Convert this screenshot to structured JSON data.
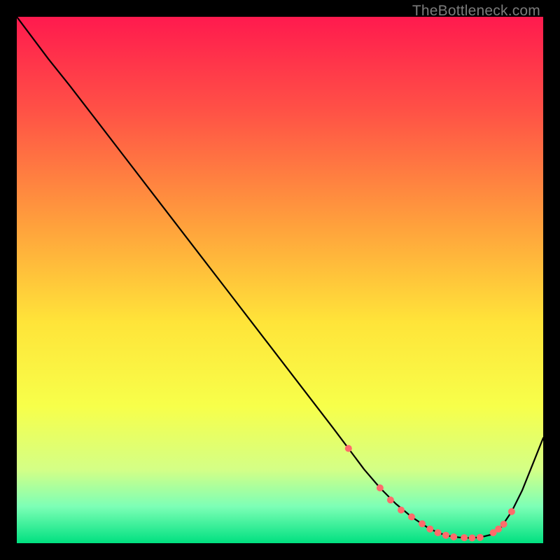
{
  "watermark": "TheBottleneck.com",
  "chart_data": {
    "type": "line",
    "title": "",
    "xlabel": "",
    "ylabel": "",
    "xlim": [
      0,
      100
    ],
    "ylim": [
      0,
      100
    ],
    "grid": false,
    "legend": false,
    "background_gradient": {
      "stops": [
        {
          "pct": 0,
          "color": "#ff1a4e"
        },
        {
          "pct": 18,
          "color": "#ff5246"
        },
        {
          "pct": 40,
          "color": "#ffa23c"
        },
        {
          "pct": 58,
          "color": "#ffe439"
        },
        {
          "pct": 74,
          "color": "#f7ff4a"
        },
        {
          "pct": 86,
          "color": "#d4ff86"
        },
        {
          "pct": 93,
          "color": "#7dffb6"
        },
        {
          "pct": 100,
          "color": "#00e080"
        }
      ]
    },
    "series": [
      {
        "name": "bottleneck-curve",
        "color": "#000000",
        "x": [
          0,
          6,
          10,
          15,
          20,
          25,
          30,
          35,
          40,
          45,
          50,
          55,
          60,
          63,
          66,
          69,
          72,
          75,
          78,
          80,
          82,
          84,
          86,
          88,
          90,
          92,
          94,
          96,
          98,
          100
        ],
        "y": [
          100,
          92,
          87,
          80.5,
          74,
          67.5,
          61,
          54.5,
          48,
          41.5,
          35,
          28.5,
          22,
          18,
          14,
          10.5,
          7.5,
          5,
          3,
          2,
          1.4,
          1.1,
          1,
          1.1,
          1.6,
          3,
          6,
          10,
          15,
          20
        ]
      }
    ],
    "markers": {
      "name": "recommended-range",
      "color": "#ff6b6b",
      "radius": 5,
      "points": [
        {
          "x": 63,
          "y": 18
        },
        {
          "x": 69,
          "y": 10.5
        },
        {
          "x": 71,
          "y": 8.2
        },
        {
          "x": 73,
          "y": 6.3
        },
        {
          "x": 75,
          "y": 5
        },
        {
          "x": 77,
          "y": 3.7
        },
        {
          "x": 78.5,
          "y": 2.7
        },
        {
          "x": 80,
          "y": 2
        },
        {
          "x": 81.5,
          "y": 1.5
        },
        {
          "x": 83,
          "y": 1.2
        },
        {
          "x": 85,
          "y": 1.05
        },
        {
          "x": 86.5,
          "y": 1
        },
        {
          "x": 88,
          "y": 1.1
        },
        {
          "x": 90.5,
          "y": 2
        },
        {
          "x": 91.5,
          "y": 2.7
        },
        {
          "x": 92.5,
          "y": 3.6
        },
        {
          "x": 94,
          "y": 6
        }
      ]
    }
  }
}
